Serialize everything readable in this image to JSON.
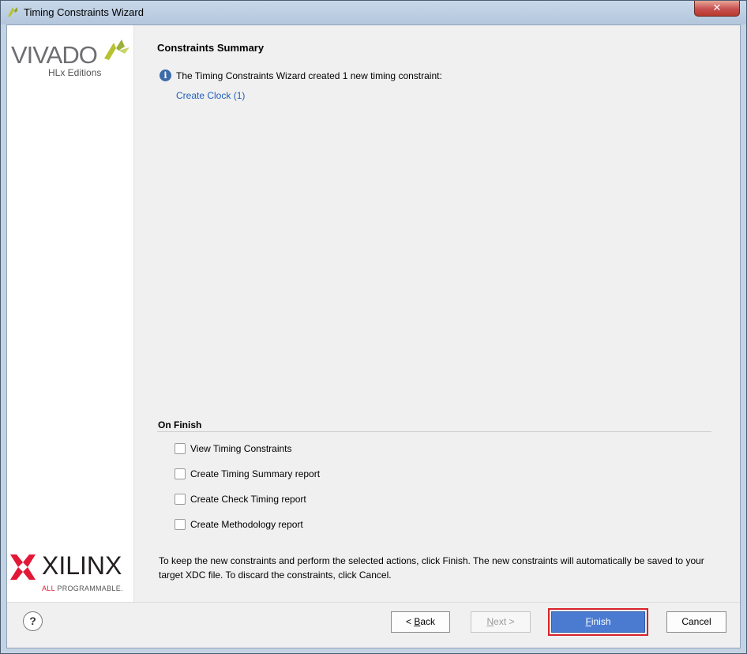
{
  "window": {
    "title": "Timing Constraints Wizard",
    "close_glyph": "✕"
  },
  "sidebar": {
    "product_name": "VIVADO",
    "product_edition": "HLx Editions",
    "vendor_name": "XILINX",
    "vendor_tagline_prefix": "ALL",
    "vendor_tagline_suffix": " PROGRAMMABLE."
  },
  "main": {
    "title": "Constraints Summary",
    "info_text": "The Timing Constraints Wizard created 1 new timing constraint:",
    "info_icon": "i",
    "created_link": "Create Clock (1)",
    "on_finish": {
      "title": "On Finish",
      "options": [
        {
          "label": "View Timing Constraints",
          "checked": false
        },
        {
          "label": "Create Timing Summary report",
          "checked": false
        },
        {
          "label": "Create Check Timing report",
          "checked": false
        },
        {
          "label": "Create Methodology report",
          "checked": false
        }
      ]
    },
    "footer_text": "To keep the new constraints and perform the selected actions, click Finish. The new constraints will automatically be saved to your target XDC file. To discard the constraints, click Cancel."
  },
  "buttons": {
    "help": "?",
    "back_prefix": "< ",
    "back_key": "B",
    "back_rest": "ack",
    "next_key": "N",
    "next_rest": "ext >",
    "finish_key": "F",
    "finish_rest": "inish",
    "cancel": "Cancel"
  },
  "colors": {
    "accent": "#4a7bd0",
    "link": "#1f5fbf",
    "highlight": "#d8232a"
  }
}
